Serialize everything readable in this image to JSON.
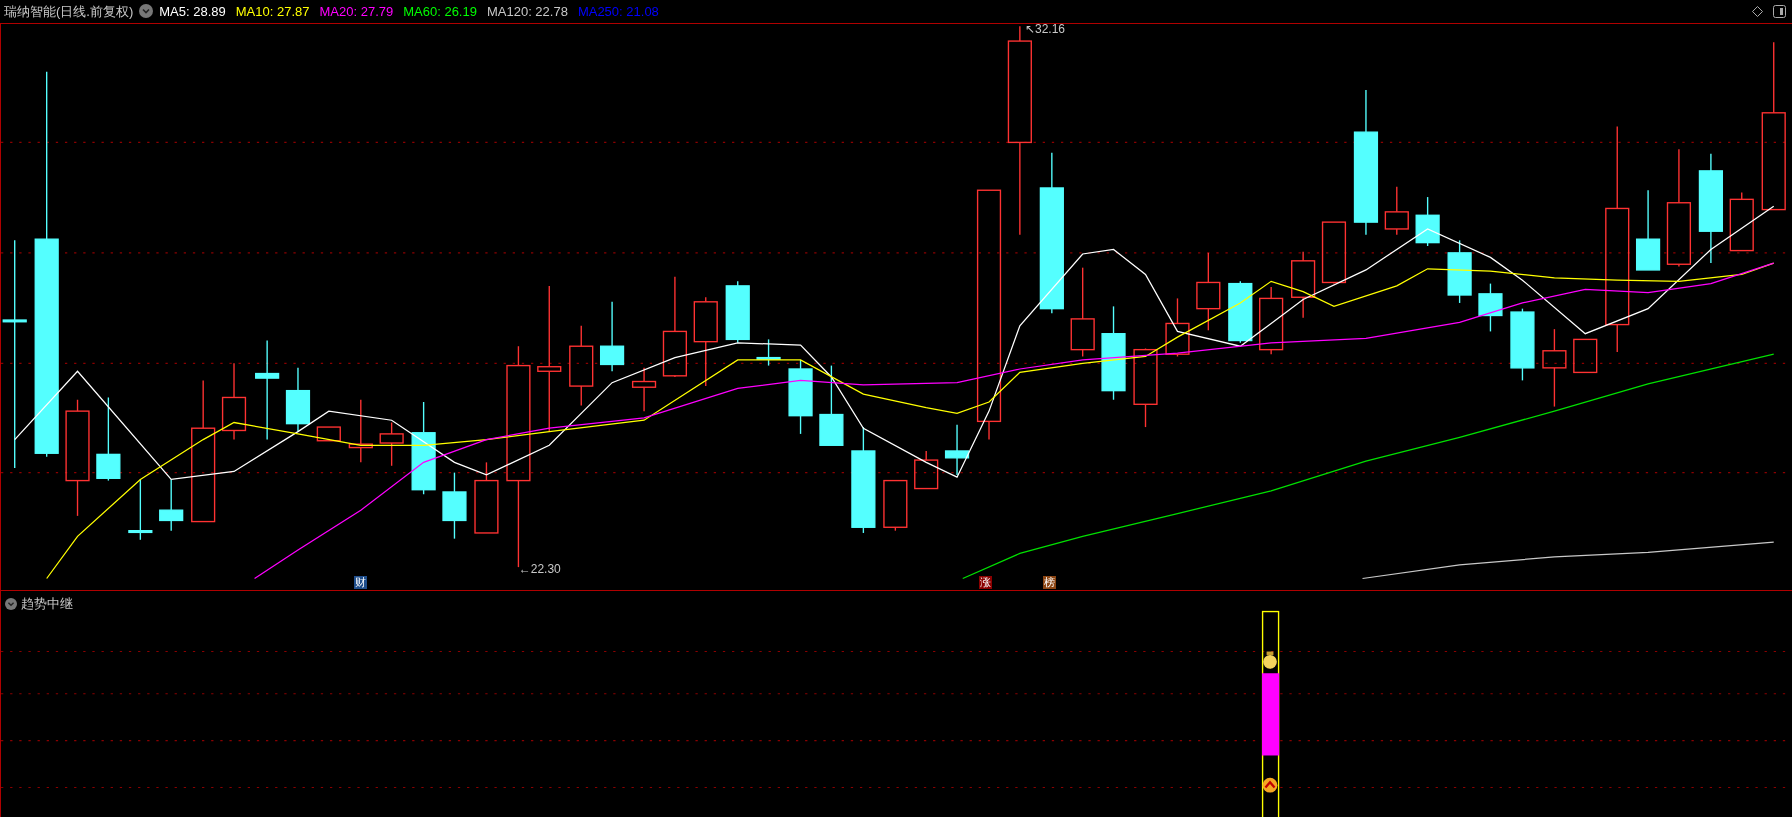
{
  "header": {
    "title": "瑞纳智能(日线.前复权)",
    "indicators": [
      {
        "label": "MA5: 28.89",
        "color": "#ffffff"
      },
      {
        "label": "MA10: 27.87",
        "color": "#ffff00"
      },
      {
        "label": "MA20: 27.79",
        "color": "#ff00ff"
      },
      {
        "label": "MA60: 26.19",
        "color": "#00ff00"
      },
      {
        "label": "MA120: 22.78",
        "color": "#c8c8c8"
      },
      {
        "label": "MA250: 21.08",
        "color": "#0000ff"
      }
    ]
  },
  "price_labels": [
    {
      "kind": "high",
      "text": "↖32.16"
    },
    {
      "kind": "low",
      "text": "←22.30"
    }
  ],
  "event_markers": [
    {
      "text": "财",
      "color": "#1f4e8c"
    },
    {
      "text": "涨",
      "color": "#8b0000"
    },
    {
      "text": "榜",
      "color": "#8b4513"
    }
  ],
  "indicator_pane": {
    "title": "趋势中继"
  }
}
